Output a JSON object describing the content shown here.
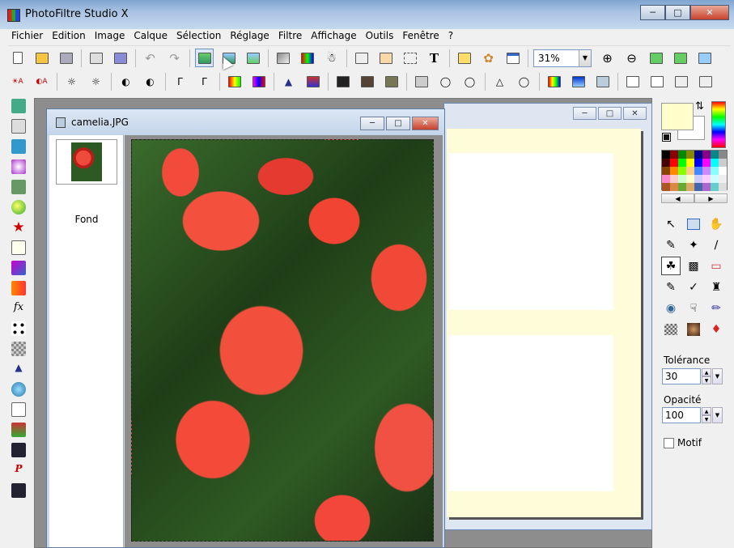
{
  "window": {
    "title": "PhotoFiltre Studio X"
  },
  "menu": [
    "Fichier",
    "Edition",
    "Image",
    "Calque",
    "Sélection",
    "Réglage",
    "Filtre",
    "Affichage",
    "Outils",
    "Fenêtre",
    "?"
  ],
  "toolbar": {
    "zoom_value": "31%",
    "row1_icons": [
      "new-icon",
      "open-icon",
      "save-icon",
      "print-icon",
      "scan-icon",
      "undo-icon",
      "redo-icon",
      "paste-layer-icon",
      "image-size-icon",
      "canvas-size-icon",
      "fade-icon",
      "palette-icon",
      "color-picker-icon",
      "camera-icon",
      "crop-icon",
      "selection-icon",
      "text-icon",
      "browser-icon",
      "plugin-icon",
      "window-icon",
      "zoom-in-icon",
      "zoom-out-icon",
      "fit-icon",
      "actual-size-icon",
      "fullscreen-icon"
    ],
    "row2_icons": [
      "auto-levels-icon",
      "auto-contrast-icon",
      "brightness-minus-icon",
      "brightness-plus-icon",
      "contrast-minus-icon",
      "contrast-plus-icon",
      "gamma-minus-icon",
      "gamma-plus-icon",
      "saturation-minus-icon",
      "saturation-plus-icon",
      "levels-icon",
      "histogram-icon",
      "blur-icon",
      "sharpen-icon",
      "emboss-icon",
      "dither-icon",
      "drop-icon",
      "drops-icon",
      "triangle-icon",
      "drop-alt-icon",
      "gradient-icon",
      "rgb-icon",
      "dust-icon",
      "mirror-icon",
      "flip-icon",
      "rotate-left-icon",
      "rotate-right-icon"
    ]
  },
  "document": {
    "filename": "camelia.JPG",
    "layer_name": "Fond"
  },
  "colors": {
    "foreground": "#ffffcc",
    "background": "#ffffff"
  },
  "tool_options": {
    "tolerance_label": "Tolérance",
    "tolerance_value": "30",
    "opacity_label": "Opacité",
    "opacity_value": "100",
    "motif_label": "Motif"
  },
  "tools": [
    "pointer-icon",
    "layer-manager-icon",
    "hand-icon",
    "eyedropper-icon",
    "magic-wand-icon",
    "line-icon",
    "paint-bucket-icon",
    "spray-icon",
    "eraser-icon",
    "brush-icon",
    "advanced-brush-icon",
    "stamp-icon",
    "blur-drop-icon",
    "finger-icon",
    "smudge-icon",
    "pattern-icon",
    "clone-icon",
    "strawberry-icon"
  ]
}
